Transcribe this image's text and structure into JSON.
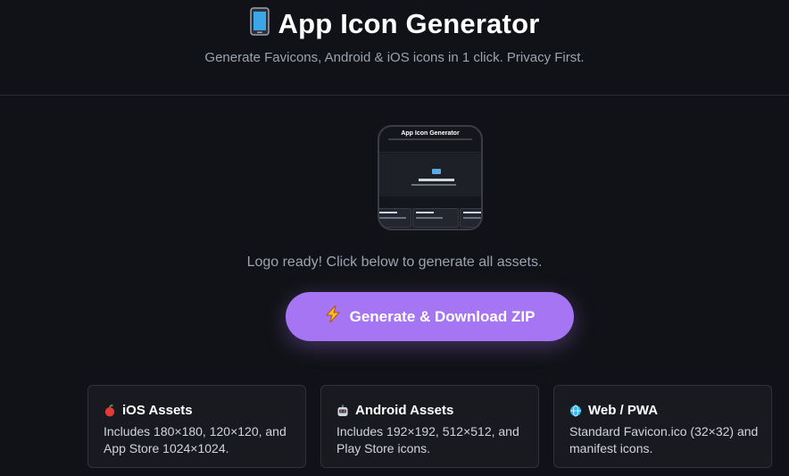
{
  "header": {
    "title": "App Icon Generator",
    "subtitle": "Generate Favicons, Android & iOS icons in 1 click. Privacy First."
  },
  "preview": {
    "title": "App Icon Generator"
  },
  "status_text": "Logo ready! Click below to generate all assets.",
  "generate_button": {
    "label": "Generate & Download ZIP",
    "color": "#a575f3"
  },
  "cards": [
    {
      "icon": "apple-icon",
      "title": "iOS Assets",
      "desc": "Includes 180×180, 120×120, and App Store 1024×1024."
    },
    {
      "icon": "robot-icon",
      "title": "Android Assets",
      "desc": "Includes 192×192, 512×512, and Play Store icons."
    },
    {
      "icon": "globe-icon",
      "title": "Web / PWA",
      "desc": "Standard Favicon.ico (32×32) and manifest icons."
    }
  ],
  "colors": {
    "background": "#111217",
    "card_bg": "#181a20",
    "accent": "#a575f3"
  }
}
